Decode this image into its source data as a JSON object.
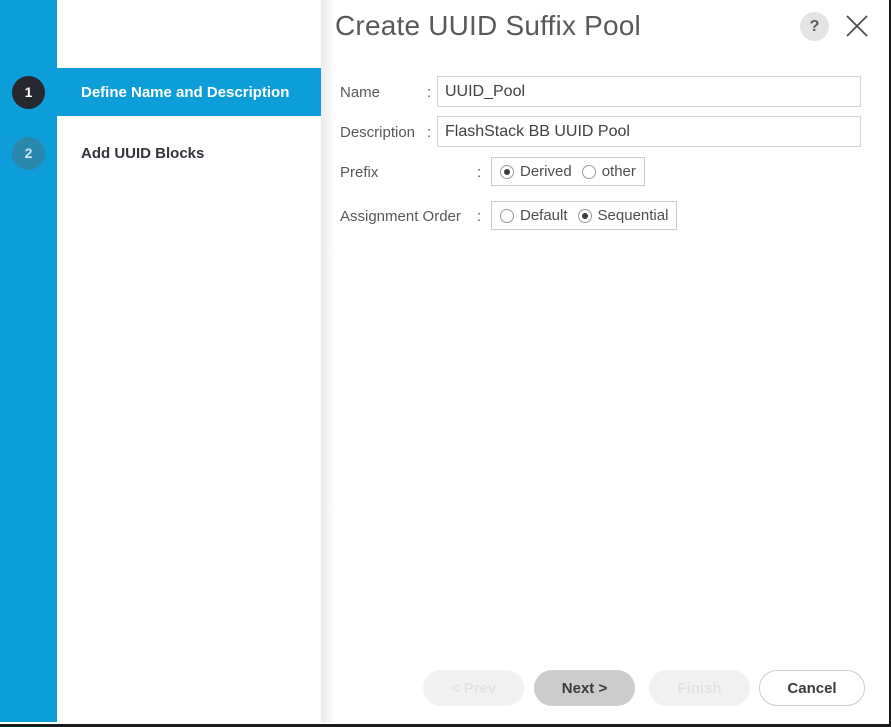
{
  "dialog": {
    "title": "Create UUID Suffix Pool",
    "help_icon_label": "?",
    "help_icon_name": "help-icon",
    "close_icon_name": "close-icon"
  },
  "wizard": {
    "steps": [
      {
        "number": "1",
        "label": "Define Name and Description",
        "state": "active"
      },
      {
        "number": "2",
        "label": "Add UUID Blocks",
        "state": "idle"
      }
    ]
  },
  "form": {
    "name": {
      "label": "Name",
      "colon": ":",
      "value": "UUID_Pool",
      "placeholder": ""
    },
    "description": {
      "label": "Description",
      "colon": ":",
      "value": "FlashStack BB UUID Pool",
      "placeholder": ""
    },
    "prefix": {
      "label": "Prefix",
      "colon": ":",
      "options": [
        {
          "label": "Derived",
          "checked": true
        },
        {
          "label": "other",
          "checked": false
        }
      ]
    },
    "assignment_order": {
      "label": "Assignment Order",
      "colon": ":",
      "options": [
        {
          "label": "Default",
          "checked": false
        },
        {
          "label": "Sequential",
          "checked": true
        }
      ]
    }
  },
  "footer": {
    "prev": "< Prev",
    "next": "Next >",
    "finish": "Finish",
    "cancel": "Cancel"
  },
  "colors": {
    "brand_blue": "#0d9dd9",
    "step_current": "#27282d",
    "step_upcoming": "#2a87ad",
    "title_gray": "#58595b",
    "primary_button": "#cccccc"
  }
}
